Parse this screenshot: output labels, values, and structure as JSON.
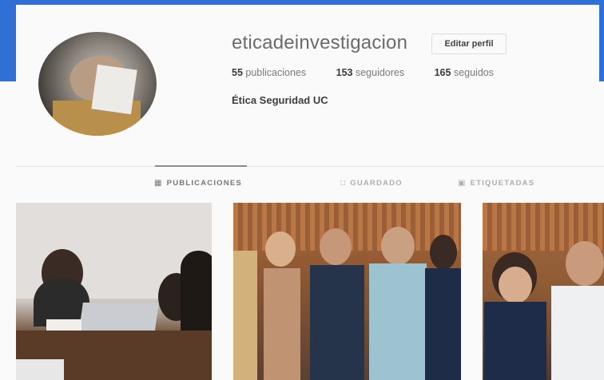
{
  "profile": {
    "username": "eticadeinvestigacion",
    "edit_label": "Editar perfil",
    "stats": [
      {
        "count": "55",
        "label": "publicaciones"
      },
      {
        "count": "153",
        "label": "seguidores"
      },
      {
        "count": "165",
        "label": "seguidos"
      }
    ],
    "full_name": "Ética Seguridad UC"
  },
  "tabs": [
    {
      "label": "PUBLICACIONES",
      "icon": "grid-icon",
      "active": true
    },
    {
      "label": "GUARDADO",
      "icon": "bookmark-icon",
      "active": false
    },
    {
      "label": "ETIQUETADAS",
      "icon": "tag-icon",
      "active": false
    }
  ],
  "colors": {
    "frame_blue": "#2f6fd6",
    "background": "#fafafa"
  }
}
